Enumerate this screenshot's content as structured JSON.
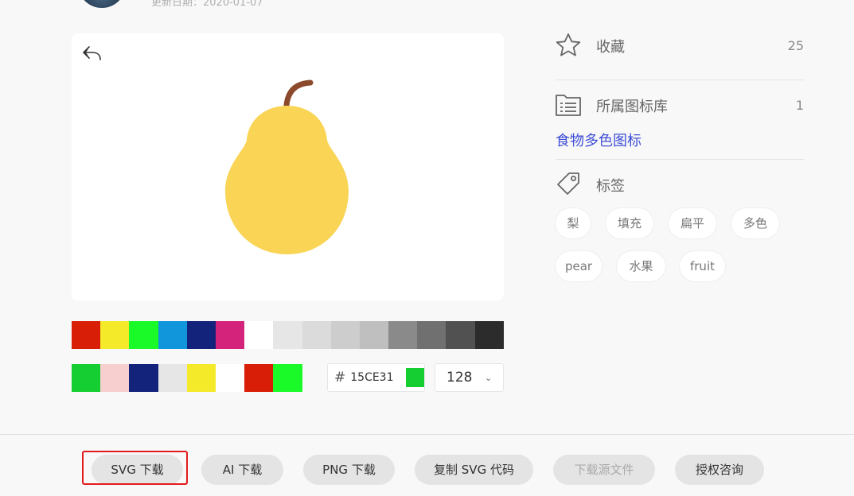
{
  "header": {
    "update_date": "更新日期：2020-01-07"
  },
  "preview": {
    "undo_icon": "undo-icon",
    "icon_subject": "pear"
  },
  "palette": {
    "swatches": [
      "#d81e06",
      "#f4ea2a",
      "#1afa29",
      "#1296db",
      "#13227a",
      "#d4237a",
      "#ffffff",
      "#e6e6e6",
      "#dbdbdb",
      "#cdcdcd",
      "#bfbfbf",
      "#8a8a8a",
      "#707070",
      "#515151",
      "#2c2c2c"
    ]
  },
  "used_colors": {
    "swatches": [
      "#15ce31",
      "#f7cfcf",
      "#13227a",
      "#e6e6e6",
      "#f4ea2a",
      "#ffffff",
      "#d81e06",
      "#1afa29"
    ]
  },
  "color_input": {
    "hash": "#",
    "value": "15CE31",
    "chip_color": "#15CE31"
  },
  "size_select": {
    "value": "128"
  },
  "sidebar": {
    "favorites": {
      "label": "收藏",
      "count": "25",
      "icon": "star-icon"
    },
    "library": {
      "label": "所属图标库",
      "count": "1",
      "icon": "folder-list-icon",
      "link": "食物多色图标"
    },
    "tags": {
      "label": "标签",
      "icon": "tag-icon",
      "items": [
        "梨",
        "填充",
        "扁平",
        "多色",
        "pear",
        "水果",
        "fruit"
      ]
    }
  },
  "actions": {
    "svg_download": "SVG 下载",
    "ai_download": "AI 下载",
    "png_download": "PNG 下载",
    "copy_svg": "复制 SVG 代码",
    "source_download": "下载源文件",
    "license": "授权咨询"
  }
}
